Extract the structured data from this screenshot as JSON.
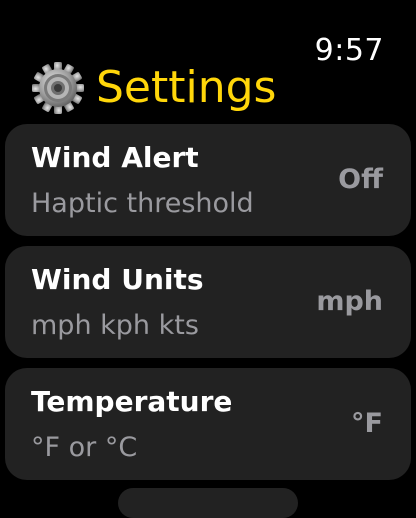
{
  "status": {
    "time": "9:57"
  },
  "header": {
    "title": "Settings",
    "icon": "gear-icon",
    "title_color": "#FFD60A"
  },
  "settings": [
    {
      "title": "Wind Alert",
      "subtitle": "Haptic threshold",
      "value": "Off"
    },
    {
      "title": "Wind Units",
      "subtitle": "mph kph kts",
      "value": "mph"
    },
    {
      "title": "Temperature",
      "subtitle": "°F or °C",
      "value": "°F"
    }
  ],
  "colors": {
    "background": "#000000",
    "row": "#222222",
    "secondary_text": "#9A9A9F"
  }
}
